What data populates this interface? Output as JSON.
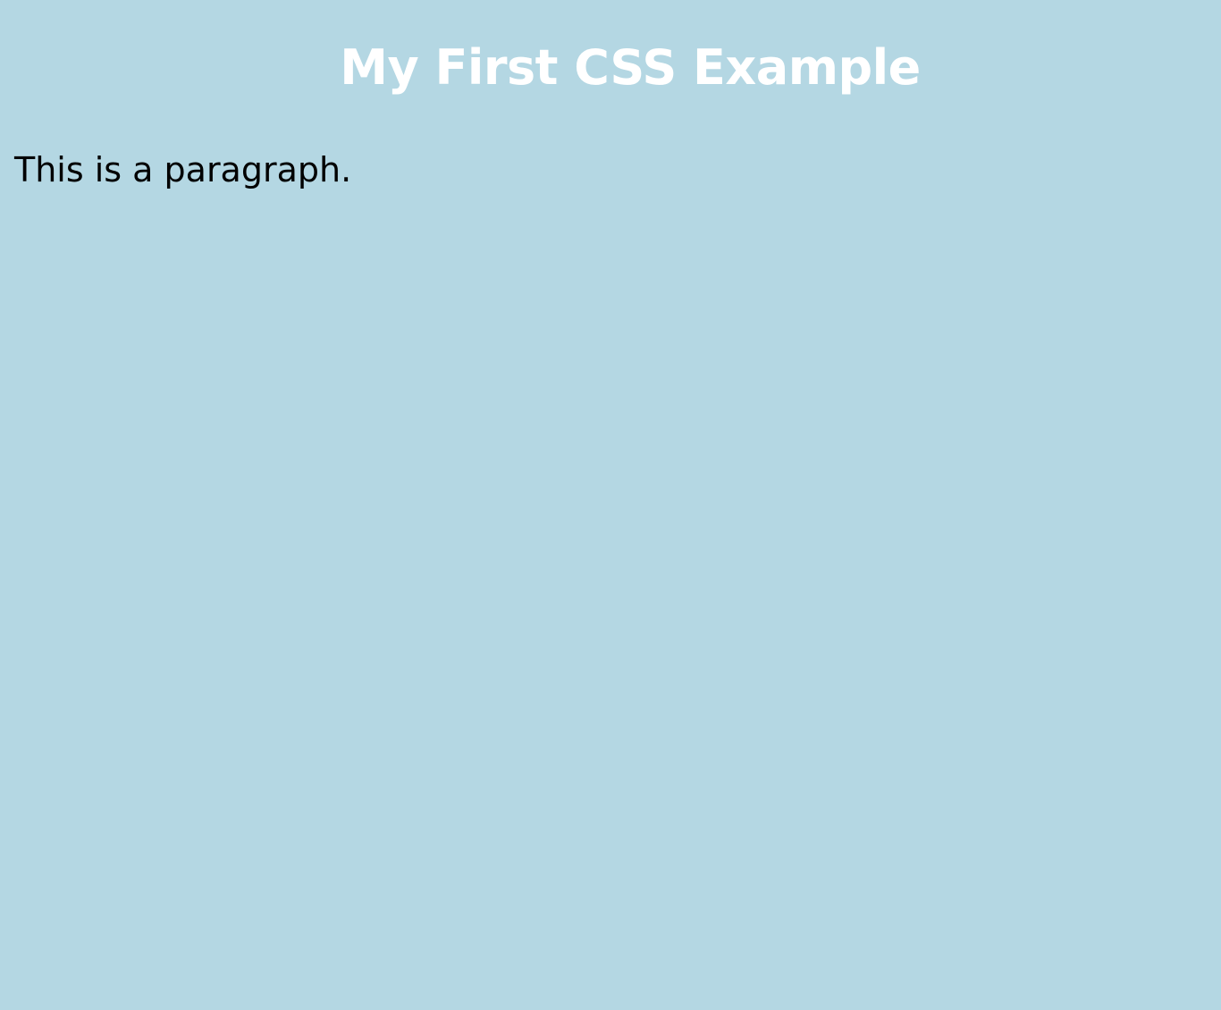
{
  "page": {
    "title": "My First CSS Example",
    "paragraph": "This is a paragraph."
  },
  "colors": {
    "background": "#b4d7e3",
    "title": "#ffffff",
    "paragraph": "#000000"
  }
}
